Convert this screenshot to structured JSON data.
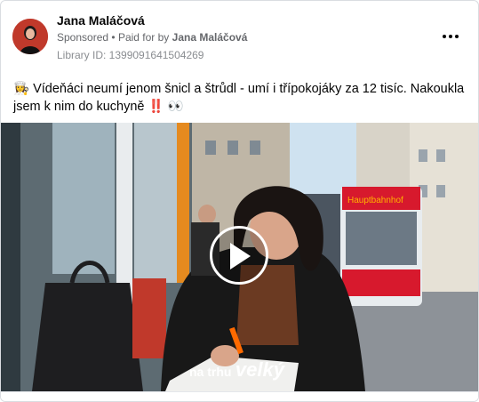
{
  "post": {
    "author": "Jana Maláčová",
    "sponsored": "Sponsored",
    "separator": "•",
    "paid_for_prefix": "Paid for by",
    "paid_by": "Jana Maláčová",
    "library_id": "Library ID: 1399091641504269",
    "text": "Vídeňáci neumí jenom šnicl a štrůdl - umí i třípokojáky za 12 tisíc. Nakoukla jsem k nim do kuchyně",
    "emoji_lead": "👩‍🍳",
    "emoji_tail": "‼️ 👀"
  },
  "video": {
    "logo_small": "na trhu",
    "logo_big": "velký",
    "bus_sign": "Hauptbahnhof"
  },
  "icons": {
    "more": "more-horizontal-icon",
    "play": "play-icon"
  },
  "colors": {
    "text": "#050505",
    "secondary": "#65676b",
    "avatar_bg": "#c0392b",
    "bus_red": "#d7192d"
  }
}
